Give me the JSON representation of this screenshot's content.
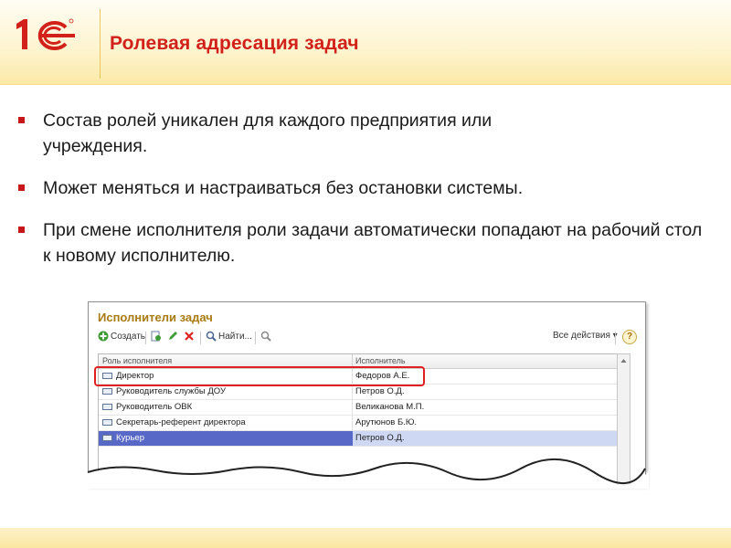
{
  "slide": {
    "title": "Ролевая адресация задач",
    "bullets": [
      "Состав ролей уникален для каждого предприятия или учреждения.",
      "Может меняться и настраиваться без остановки системы.",
      "При смене исполнителя роли задачи автоматически попадают на рабочий стол к новому исполнителю."
    ]
  },
  "logo": {
    "icon": "1c-logo",
    "color": "#d2211a"
  },
  "window": {
    "title": "Исполнители задач",
    "toolbar": {
      "create_label": "Создать",
      "find_label": "Найти...",
      "all_actions_label": "Все действия ▾",
      "help_label": "?"
    },
    "columns": [
      "Роль исполнителя",
      "Исполнитель"
    ],
    "rows": [
      {
        "role": "Директор",
        "performer": "Федоров А.Е."
      },
      {
        "role": "Руководитель службы ДОУ",
        "performer": "Петров О.Д."
      },
      {
        "role": "Руководитель ОВК",
        "performer": "Великанова М.П."
      },
      {
        "role": "Секретарь-референт директора",
        "performer": "Арутюнов Б.Ю."
      },
      {
        "role": "Курьер",
        "performer": "Петров О.Д."
      }
    ],
    "selected_row": "Курьер",
    "highlighted_row": "Директор"
  },
  "colors": {
    "accent_red": "#d2211a",
    "selection": "#5768c6",
    "window_title": "#a87a12"
  }
}
